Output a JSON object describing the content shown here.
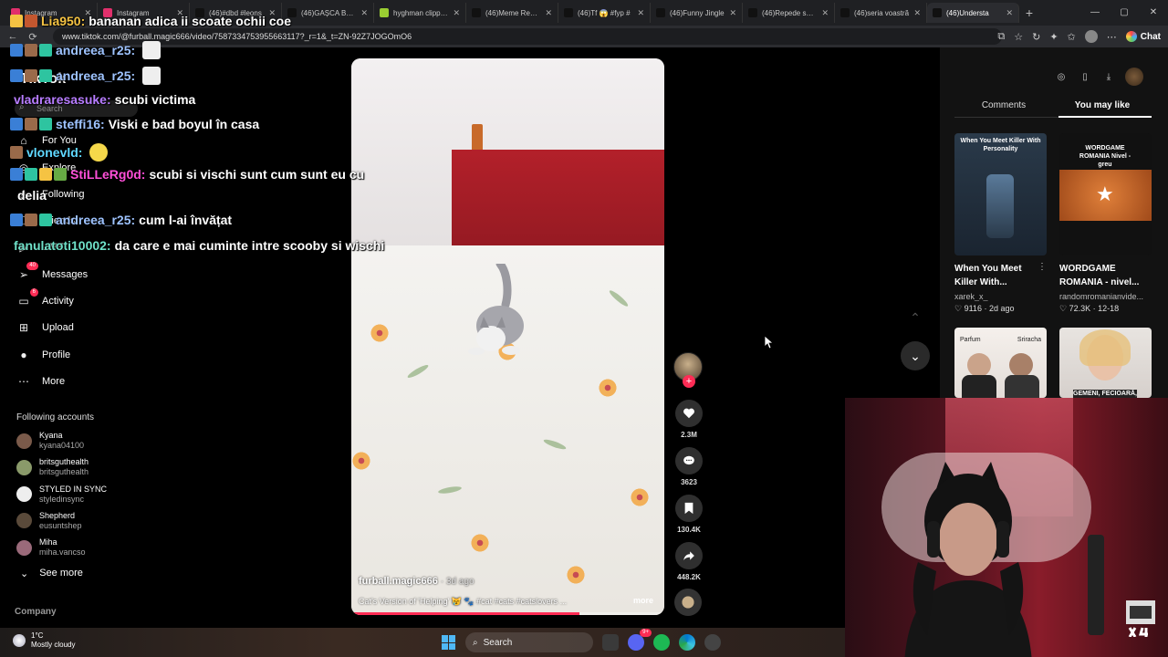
{
  "browser": {
    "tabs": [
      {
        "label": "Instagram",
        "color": "#e1306c"
      },
      {
        "label": "Instagram",
        "color": "#e1306c"
      },
      {
        "label": "(46)#dbd #leons",
        "color": "#111111"
      },
      {
        "label": "(46)GAȘCA BACA",
        "color": "#111111"
      },
      {
        "label": "hyghman clipped",
        "color": "#9acd32"
      },
      {
        "label": "(46)Meme Rewin",
        "color": "#111111"
      },
      {
        "label": "(46)Tf 😱 #fyp #",
        "color": "#111111"
      },
      {
        "label": "(46)Funny Jingle",
        "color": "#111111"
      },
      {
        "label": "(46)Repede sariti",
        "color": "#111111"
      },
      {
        "label": "(46)seria voastră",
        "color": "#111111"
      },
      {
        "label": "(46)Understa",
        "color": "#111111",
        "active": true
      }
    ],
    "new_tab": "+",
    "url": "www.tiktok.com/@furball.magic666/video/7587334753955663117?_r=1&_t=ZN-92Z7JOGOmO6",
    "chat_label": "Chat"
  },
  "sidebar": {
    "logo": "TikTok",
    "search_placeholder": "Search",
    "items": [
      {
        "label": "For You",
        "icon": "home-icon"
      },
      {
        "label": "Explore",
        "icon": "compass-icon"
      },
      {
        "label": "Following",
        "icon": "users-icon"
      },
      {
        "label": "Friends",
        "icon": "friends-icon"
      },
      {
        "label": "LIVE",
        "icon": "live-icon"
      },
      {
        "label": "Messages",
        "icon": "send-icon",
        "badge": "40"
      },
      {
        "label": "Activity",
        "icon": "activity-icon",
        "badge": "6"
      },
      {
        "label": "Upload",
        "icon": "plus-square-icon"
      },
      {
        "label": "Profile",
        "icon": "profile-icon"
      },
      {
        "label": "More",
        "icon": "more-icon"
      }
    ],
    "following_title": "Following accounts",
    "accounts": [
      {
        "name": "Kyana",
        "handle": "kyana04100",
        "color": "#7a5a4a"
      },
      {
        "name": "britsguthealth",
        "handle": "britsguthealth",
        "color": "#8a9a6a"
      },
      {
        "name": "STYLED IN SYNC",
        "handle": "styledinsync",
        "color": "#eeeeee"
      },
      {
        "name": "Shepherd",
        "handle": "eusuntshep",
        "color": "#5a4a3a"
      },
      {
        "name": "Miha",
        "handle": "miha.vancso",
        "color": "#9a6a7a"
      }
    ],
    "see_more": "See more",
    "company": "Company"
  },
  "chat_overlay": [
    {
      "user": "Lia950:",
      "msg": "bananan adica ii scoate ochii coe",
      "color": "#f5c343"
    },
    {
      "user": "andreea_r25:",
      "msg": "",
      "color": "#9ec3ff"
    },
    {
      "user": "andreea_r25:",
      "msg": "",
      "color": "#9ec3ff"
    },
    {
      "user": "vladraresasuke:",
      "msg": "scubi victima",
      "color": "#b77cff"
    },
    {
      "user": "steffi16:",
      "msg": "Viski e bad boyul în casa",
      "color": "#9ec3ff"
    },
    {
      "user": "vlonevld:",
      "msg": "",
      "color": "#5fd8ff"
    },
    {
      "user": "StiLLeRg0d:",
      "msg": "scubi si vischi sunt cum sunt eu cu",
      "color": "#ff4fd8"
    },
    {
      "user": "",
      "msg": "delia",
      "color": "#ffffff"
    },
    {
      "user": "andreea_r25:",
      "msg": "cum l-ai învățat",
      "color": "#9ec3ff"
    },
    {
      "user": "fanulatoti10002:",
      "msg": "da care e mai cuminte intre scooby si wischi",
      "color": "#6fe0c8"
    }
  ],
  "video": {
    "username": "furball.magic666",
    "age": "· 3d ago",
    "description": "Cat's Version of 'Helping' 😿 🐾 #cat #cats #catslovers ...",
    "more": "more",
    "progress": 0.73
  },
  "actions": {
    "likes": "2.3M",
    "comments": "3623",
    "saves": "130.4K",
    "shares": "448.2K"
  },
  "right_panel": {
    "tab_comments": "Comments",
    "tab_you_may_like": "You may like",
    "cards": [
      {
        "thumb_text": "When You Meet Killer With Personality",
        "title": "When You Meet Killer With...",
        "user": "xarek_x_",
        "meta": "9116 · 2d ago"
      },
      {
        "thumb_text": "WORDGAME ROMANIA Nivel - greu",
        "title": "WORDGAME ROMANIA - nivel...",
        "user": "randomromanianvide...",
        "meta": "72.3K · 12-18"
      },
      {
        "thumb_text_left": "Parfum",
        "thumb_text_right": "Sriracha"
      },
      {
        "thumb_text": "GEMENI, FECIOARĂ,"
      }
    ]
  },
  "taskbar": {
    "temp": "1°C",
    "weather": "Mostly cloudy",
    "search": "Search",
    "discord_badge": "9+"
  }
}
